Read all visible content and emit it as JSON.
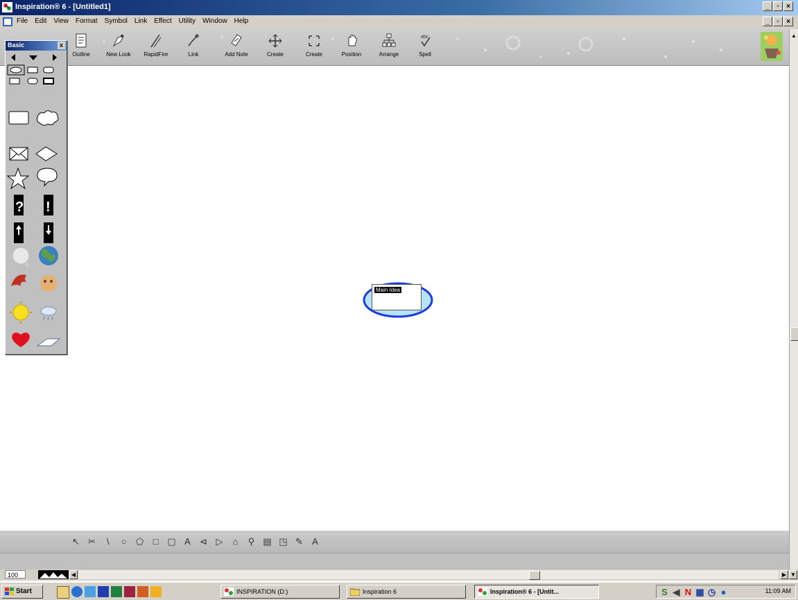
{
  "window": {
    "title": "Inspiration® 6 - [Untitled1]",
    "controls": [
      "minimize-icon",
      "maximize-icon",
      "close-icon"
    ]
  },
  "menu": {
    "items": [
      "File",
      "Edit",
      "View",
      "Format",
      "Symbol",
      "Link",
      "Effect",
      "Utility",
      "Window",
      "Help"
    ]
  },
  "toolbar": {
    "buttons": [
      {
        "label": "Outline",
        "icon": "outline-icon"
      },
      {
        "label": "New Look",
        "icon": "new-look-icon"
      },
      {
        "label": "RapidFire",
        "icon": "rapidfire-icon"
      },
      {
        "label": "Link",
        "icon": "link-icon"
      },
      {
        "label": "Add Note",
        "icon": "add-note-icon"
      },
      {
        "label": "Create",
        "icon": "create-icon"
      },
      {
        "label": "Create",
        "icon": "create-subtopic-icon"
      },
      {
        "label": "Position",
        "icon": "position-icon"
      },
      {
        "label": "Arrange",
        "icon": "arrange-icon"
      },
      {
        "label": "Spell",
        "icon": "spell-icon"
      }
    ]
  },
  "palette": {
    "title": "Basic",
    "close": "x"
  },
  "canvas": {
    "main_idea": "Main Idea"
  },
  "drawbar": {
    "tools": [
      "↖",
      "✂",
      "\\",
      "○",
      "⬠",
      "□",
      "▢",
      "A",
      "⊲",
      "▷",
      "⌂",
      "⚲",
      "▤",
      "◳",
      "✎",
      "A"
    ]
  },
  "zoom": {
    "value": "100"
  },
  "taskbar": {
    "start": "Start",
    "tasks": [
      {
        "label": "INSPIRATION (D:)",
        "active": false
      },
      {
        "label": "Inspiration 6",
        "active": false
      },
      {
        "label": "Inspiration® 6 - [Untit...",
        "active": true
      }
    ],
    "clock": "11:09 AM",
    "tray_n": "N"
  },
  "colors": {
    "titlebar": "#0a246a",
    "main_idea_fill": "#b7e3f5",
    "main_idea_border": "#1a3cdc"
  }
}
